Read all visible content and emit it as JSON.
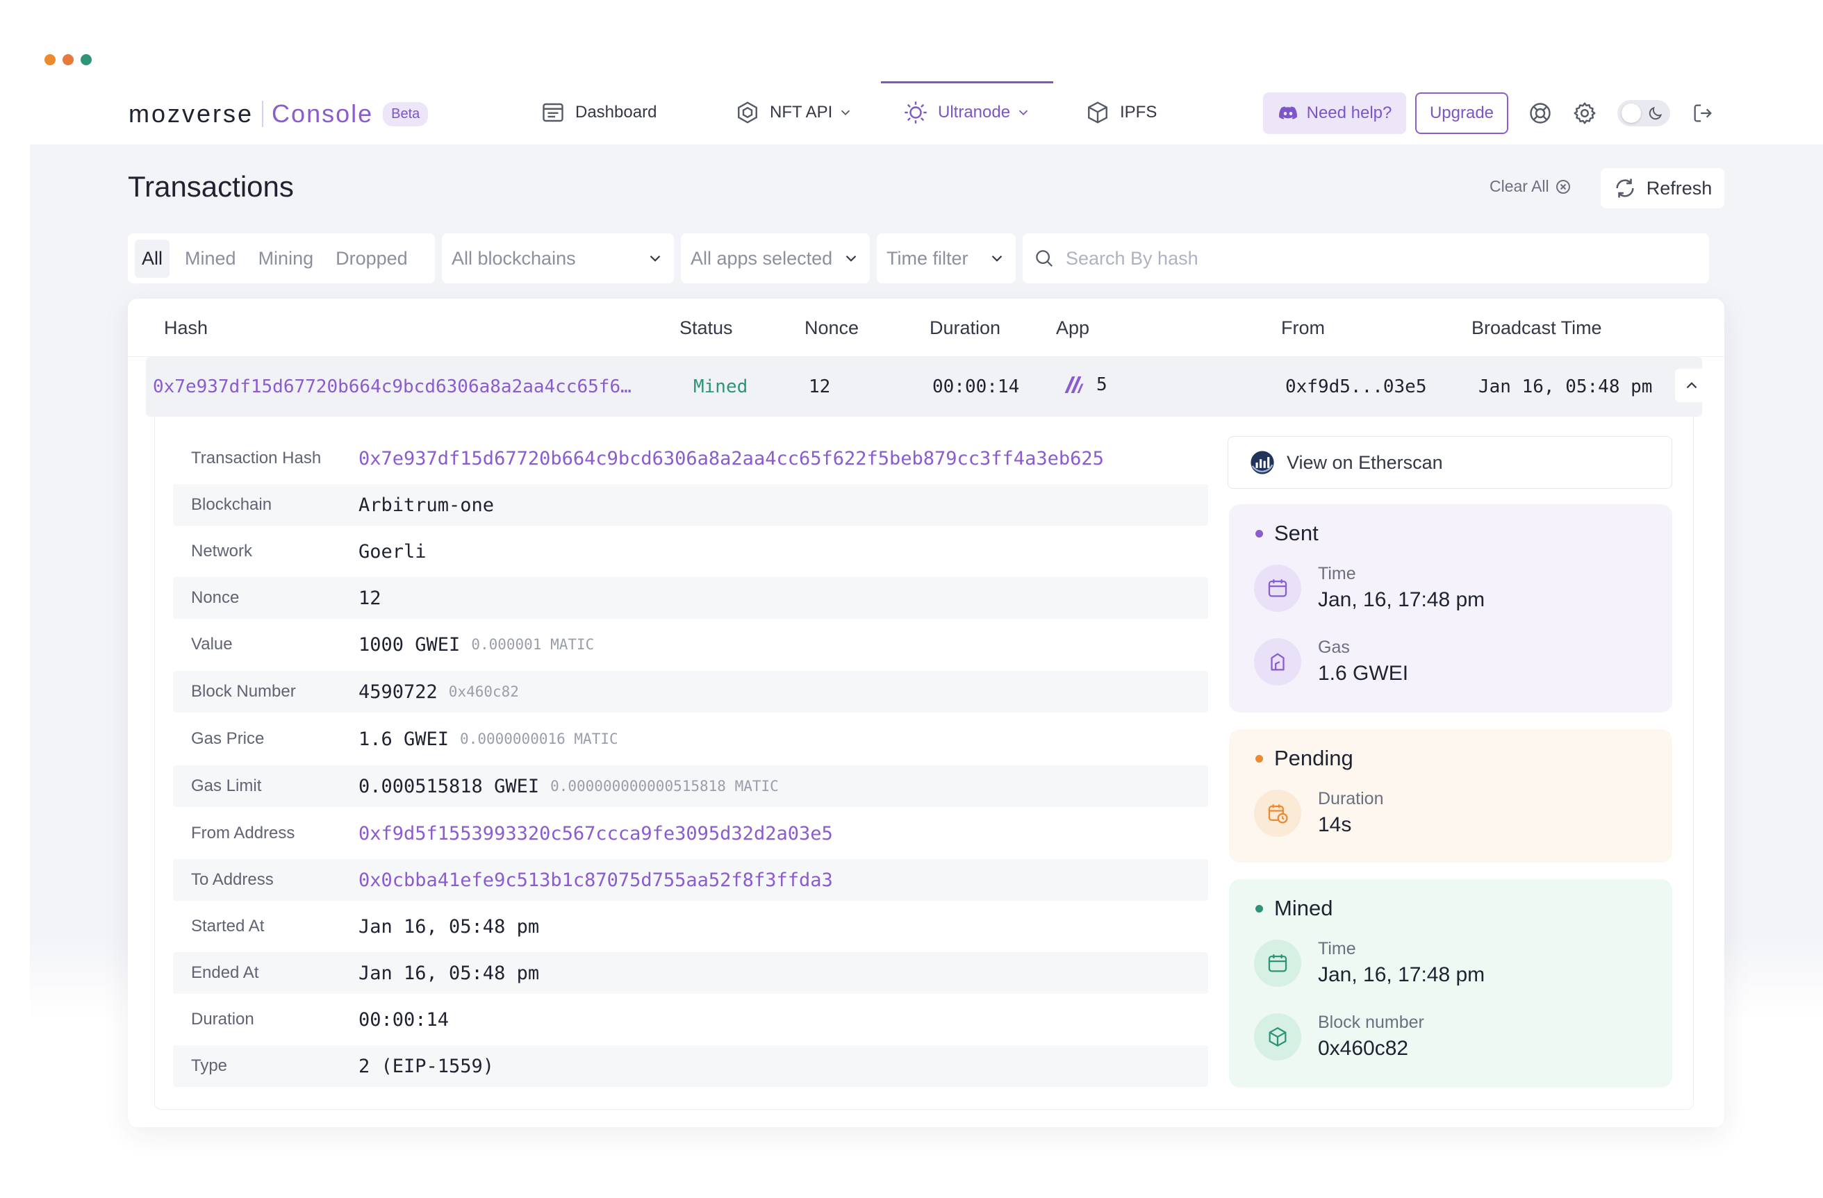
{
  "colors": {
    "accent": "#7c55c8",
    "mined": "#2e9478",
    "pending": "#ec8a2f",
    "sent": "#8a5ccf",
    "dot_orange": "#ec8a2f",
    "dot_orange2": "#e6793c",
    "dot_teal": "#2e9478"
  },
  "brand": {
    "name": "mozverse",
    "product": "Console",
    "badge": "Beta"
  },
  "nav": {
    "items": [
      {
        "label": "Dashboard",
        "icon": "dashboard-icon"
      },
      {
        "label": "NFT API",
        "icon": "hexagon-icon"
      },
      {
        "label": "Ultranode",
        "icon": "ultranode-icon",
        "active": true
      },
      {
        "label": "IPFS",
        "icon": "cube-icon"
      }
    ],
    "help_label": "Need help?",
    "upgrade_label": "Upgrade"
  },
  "page": {
    "title": "Transactions",
    "clear_all": "Clear All",
    "refresh": "Refresh"
  },
  "filters": {
    "tabs": [
      "All",
      "Mined",
      "Mining",
      "Dropped"
    ],
    "active_tab": "All",
    "blockchains": "All blockchains",
    "apps": "All apps selected",
    "time": "Time filter",
    "search_placeholder": "Search By hash"
  },
  "table": {
    "headers": {
      "hash": "Hash",
      "status": "Status",
      "nonce": "Nonce",
      "duration": "Duration",
      "app": "App",
      "from": "From",
      "broadcast": "Broadcast Time"
    },
    "row": {
      "hash": "0x7e937df15d67720b664c9bcd6306a8a2aa4cc65f6…",
      "status": "Mined",
      "nonce": "12",
      "duration": "00:00:14",
      "app": "5",
      "from": "0xf9d5...03e5",
      "broadcast": "Jan 16, 05:48 pm"
    }
  },
  "details": {
    "rows": [
      {
        "label": "Transaction Hash",
        "value": "0x7e937df15d67720b664c9bcd6306a8a2aa4cc65f622f5beb879cc3ff4a3eb625",
        "link": true
      },
      {
        "label": "Blockchain",
        "value": "Arbitrum-one"
      },
      {
        "label": "Network",
        "value": "Goerli"
      },
      {
        "label": "Nonce",
        "value": "12"
      },
      {
        "label": "Value",
        "value": "1000 GWEI",
        "sub": "0.000001 MATIC"
      },
      {
        "label": "Block Number",
        "value": "4590722",
        "sub": "0x460c82"
      },
      {
        "label": "Gas Price",
        "value": "1.6 GWEI",
        "sub": "0.0000000016 MATIC"
      },
      {
        "label": "Gas Limit",
        "value": "0.000515818 GWEI",
        "sub": "0.000000000000515818 MATIC"
      },
      {
        "label": "From Address",
        "value": "0xf9d5f1553993320c567ccca9fe3095d32d2a03e5",
        "link": true
      },
      {
        "label": "To Address",
        "value": "0x0cbba41efe9c513b1c87075d755aa52f8f3ffda3",
        "link": true
      },
      {
        "label": "Started At",
        "value": "Jan 16, 05:48 pm"
      },
      {
        "label": "Ended At",
        "value": "Jan 16, 05:48 pm"
      },
      {
        "label": "Duration",
        "value": "00:00:14"
      },
      {
        "label": "Type",
        "value": "2 (EIP-1559)"
      }
    ],
    "etherscan_label": "View on Etherscan"
  },
  "timeline": {
    "sent": {
      "title": "Sent",
      "time_label": "Time",
      "time_value": "Jan, 16, 17:48 pm",
      "gas_label": "Gas",
      "gas_value": "1.6 GWEI"
    },
    "pending": {
      "title": "Pending",
      "duration_label": "Duration",
      "duration_value": "14s"
    },
    "mined": {
      "title": "Mined",
      "time_label": "Time",
      "time_value": "Jan, 16, 17:48 pm",
      "block_label": "Block number",
      "block_value": "0x460c82"
    }
  }
}
